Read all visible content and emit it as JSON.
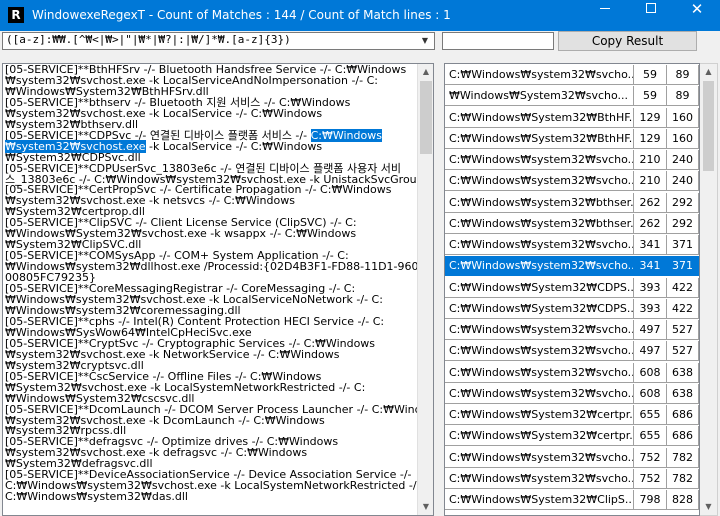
{
  "window": {
    "app_icon_letter": "R",
    "title": "WindowexeRegexT - Count of Matches : 144 / Count of Match lines : 1",
    "close_glyph": "✕"
  },
  "toolbar": {
    "regex_value": "([a-z]:₩₩.[^₩<|₩>|\"|₩*|₩?|:|₩/]*₩.[a-z]{3})",
    "dropdown_icon": "chevron-down-icon",
    "filter_value": "",
    "copy_button_label": "Copy Result"
  },
  "text_pane": {
    "lines_before_selection": [
      "[05-SERVICE]**BthHFSrv -/- Bluetooth Handsfree Service -/- C:₩Windows",
      "₩system32₩svchost.exe -k LocalServiceAndNoImpersonation -/- C:",
      "₩Windows₩System32₩BthHFSrv.dll",
      "[05-SERVICE]**bthserv -/- Bluetooth 지원 서비스 -/- C:₩Windows",
      "₩system32₩svchost.exe -k LocalService -/- C:₩Windows",
      "₩system32₩bthserv.dll"
    ],
    "selection_line_prefix": "[05-SERVICE]**CDPSvc -/- 연결된 디바이스 플랫폼 서비스 -/- ",
    "selection_part1": "C:₩Windows",
    "selection_part2": "₩system32₩svchost.exe",
    "selection_line_suffix": " -k LocalService -/- C:₩Windows",
    "lines_after_selection": [
      "₩System32₩CDPSvc.dll",
      "[05-SERVICE]**CDPUserSvc_13803e6c -/- 연결된 디바이스 플랫폼 사용자 서비",
      "스_13803e6c -/- C:₩Windows₩system32₩svchost.exe -k UnistackSvcGroup",
      "[05-SERVICE]**CertPropSvc -/- Certificate Propagation -/- C:₩Windows",
      "₩system32₩svchost.exe -k netsvcs -/- C:₩Windows",
      "₩System32₩certprop.dll",
      "[05-SERVICE]**ClipSVC -/- Client License Service (ClipSVC) -/- C:",
      "₩Windows₩System32₩svchost.exe -k wsappx -/- C:₩Windows",
      "₩System32₩ClipSVC.dll",
      "[05-SERVICE]**COMSysApp -/- COM+ System Application -/- C:",
      "₩Windows₩system32₩dllhost.exe /Processid:{02D4B3F1-FD88-11D1-960D-",
      "00805FC79235}",
      "[05-SERVICE]**CoreMessagingRegistrar -/- CoreMessaging -/- C:",
      "₩Windows₩system32₩svchost.exe -k LocalServiceNoNetwork -/- C:",
      "₩Windows₩system32₩coremessaging.dll",
      "[05-SERVICE]**cphs -/- Intel(R) Content Protection HECI Service -/- C:",
      "₩Windows₩SysWow64₩IntelCpHeciSvc.exe",
      "[05-SERVICE]**CryptSvc -/- Cryptographic Services -/- C:₩Windows",
      "₩system32₩svchost.exe -k NetworkService -/- C:₩Windows",
      "₩system32₩cryptsvc.dll",
      "[05-SERVICE]**CscService -/- Offline Files -/- C:₩Windows",
      "₩System32₩svchost.exe -k LocalSystemNetworkRestricted -/- C:",
      "₩Windows₩System32₩cscsvc.dll",
      "[05-SERVICE]**DcomLaunch -/- DCOM Server Process Launcher -/- C:₩Windows",
      "₩system32₩svchost.exe -k DcomLaunch -/- C:₩Windows",
      "₩system32₩rpcss.dll",
      "[05-SERVICE]**defragsvc -/- Optimize drives -/- C:₩Windows",
      "₩system32₩svchost.exe -k defragsvc -/- C:₩Windows",
      "₩System32₩defragsvc.dll",
      "[05-SERVICE]**DeviceAssociationService -/- Device Association Service -/-",
      "C:₩Windows₩system32₩svchost.exe -k LocalSystemNetworkRestricted -/-",
      "C:₩Windows₩system32₩das.dll"
    ]
  },
  "result_list": {
    "selected_index": 9,
    "rows": [
      {
        "path": "C:₩Windows₩system32₩svcho...",
        "start": "59",
        "end": "89"
      },
      {
        "path": "₩Windows₩System32₩svcho...",
        "start": "59",
        "end": "89"
      },
      {
        "path": "C:₩Windows₩System32₩BthHF...",
        "start": "129",
        "end": "160"
      },
      {
        "path": "C:₩Windows₩System32₩BthHF...",
        "start": "129",
        "end": "160"
      },
      {
        "path": "C:₩Windows₩system32₩svcho...",
        "start": "210",
        "end": "240"
      },
      {
        "path": "C:₩Windows₩system32₩svcho...",
        "start": "210",
        "end": "240"
      },
      {
        "path": "C:₩Windows₩system32₩bthser...",
        "start": "262",
        "end": "292"
      },
      {
        "path": "C:₩Windows₩system32₩bthser...",
        "start": "262",
        "end": "292"
      },
      {
        "path": "C:₩Windows₩system32₩svcho...",
        "start": "341",
        "end": "371"
      },
      {
        "path": "C:₩Windows₩system32₩svcho...",
        "start": "341",
        "end": "371"
      },
      {
        "path": "C:₩Windows₩System32₩CDPS...",
        "start": "393",
        "end": "422"
      },
      {
        "path": "C:₩Windows₩System32₩CDPS...",
        "start": "393",
        "end": "422"
      },
      {
        "path": "C:₩Windows₩system32₩svcho...",
        "start": "497",
        "end": "527"
      },
      {
        "path": "C:₩Windows₩system32₩svcho...",
        "start": "497",
        "end": "527"
      },
      {
        "path": "C:₩Windows₩system32₩svcho...",
        "start": "608",
        "end": "638"
      },
      {
        "path": "C:₩Windows₩system32₩svcho...",
        "start": "608",
        "end": "638"
      },
      {
        "path": "C:₩Windows₩System32₩certpr...",
        "start": "655",
        "end": "686"
      },
      {
        "path": "C:₩Windows₩System32₩certpr...",
        "start": "655",
        "end": "686"
      },
      {
        "path": "C:₩Windows₩system32₩svcho...",
        "start": "752",
        "end": "782"
      },
      {
        "path": "C:₩Windows₩system32₩svcho...",
        "start": "752",
        "end": "782"
      },
      {
        "path": "C:₩Windows₩System32₩ClipS...",
        "start": "798",
        "end": "828"
      }
    ]
  }
}
